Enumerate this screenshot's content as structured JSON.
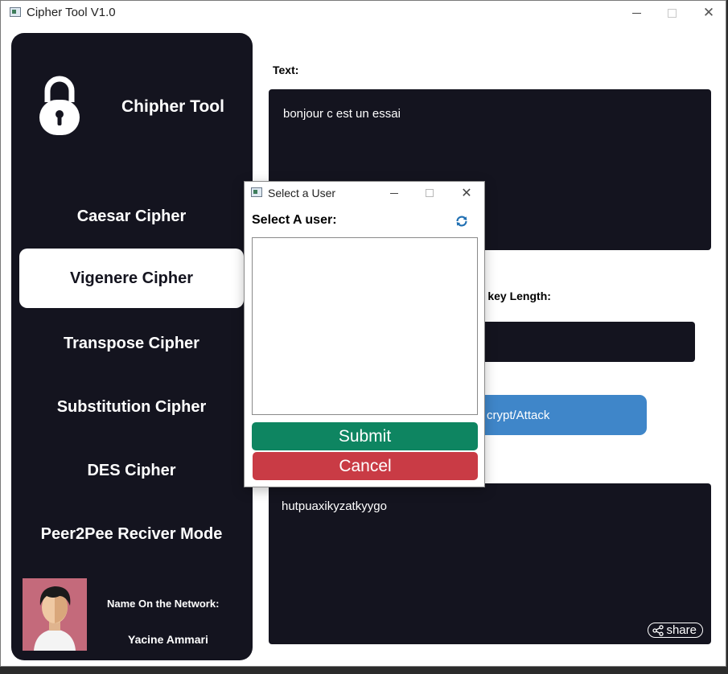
{
  "window": {
    "title": "Cipher Tool V1.0"
  },
  "sidebar": {
    "app_name": "Chipher Tool",
    "items": [
      {
        "label": "Caesar Cipher"
      },
      {
        "label": "Vigenere Cipher",
        "active": true
      },
      {
        "label": "Transpose Cipher"
      },
      {
        "label": "Substitution Cipher"
      },
      {
        "label": "DES Cipher"
      },
      {
        "label": "Peer2Pee Reciver Mode"
      }
    ],
    "network_label": "Name On the Network:",
    "network_user": "Yacine Ammari"
  },
  "main": {
    "text_label": "Text:",
    "text_value": "bonjour c est un essai",
    "key_label_partial": "r key Length:",
    "action_button_partial": "crypt/Attack",
    "output_value": "hutpuaxikyzatkyygo",
    "share_label": "share"
  },
  "dialog": {
    "title": "Select a User",
    "label": "Select A user:",
    "submit": "Submit",
    "cancel": "Cancel"
  },
  "colors": {
    "sidebar_bg": "#14141f",
    "action_blue": "#3f86c9",
    "submit_green": "#0e8561",
    "cancel_red": "#c93b45",
    "refresh_blue": "#1f6fb2"
  },
  "icons": [
    "app-icon",
    "minimize-icon",
    "maximize-icon",
    "close-icon",
    "lock-icon",
    "refresh-icon",
    "share-icon"
  ]
}
